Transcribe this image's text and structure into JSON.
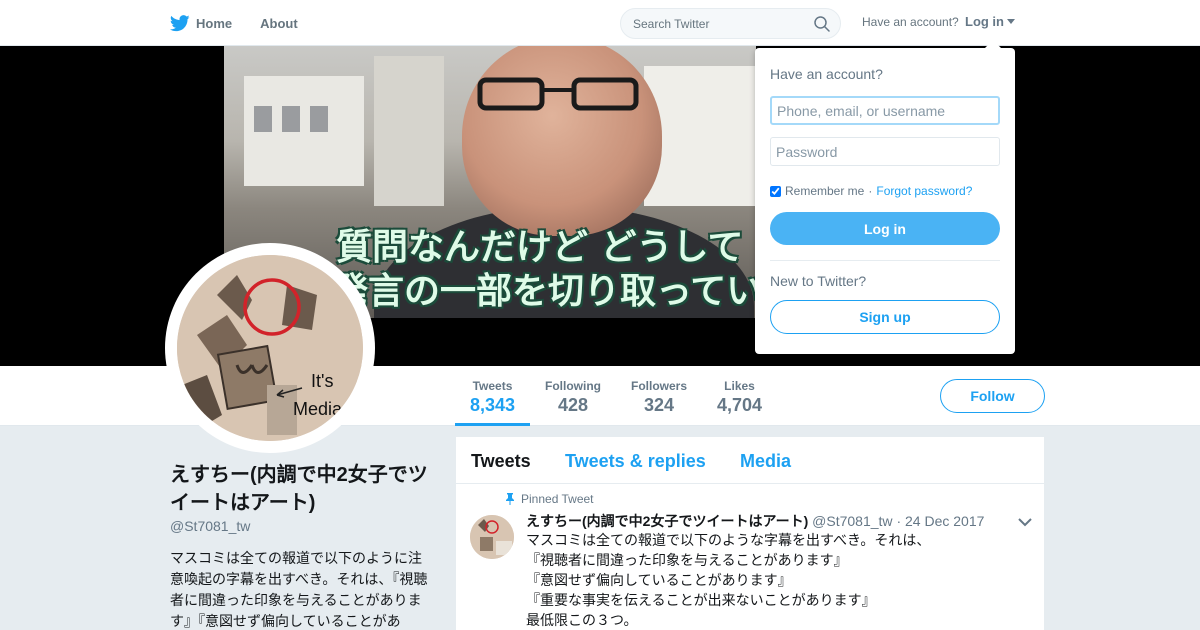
{
  "nav": {
    "home_label": "Home",
    "about_label": "About",
    "search_placeholder": "Search Twitter",
    "have_account": "Have an account?",
    "login_label": "Log in"
  },
  "header": {
    "subtitle_line1": "質問なんだけど どうして",
    "subtitle_line2": "発言の一部を切り取っている"
  },
  "avatar_caption": {
    "line1": "It's",
    "line2": "Media"
  },
  "stats": [
    {
      "label": "Tweets",
      "value": "8,343",
      "active": true
    },
    {
      "label": "Following",
      "value": "428"
    },
    {
      "label": "Followers",
      "value": "324"
    },
    {
      "label": "Likes",
      "value": "4,704"
    }
  ],
  "follow_label": "Follow",
  "profile": {
    "name": "えすちー(内調で中2女子でツイートはアート)",
    "handle": "@St7081_tw",
    "bio": "マスコミは全ての報道で以下のように注意喚起の字幕を出すべき。それは、『視聴者に間違った印象を与えることがあります』『意図せず偏向していることがあ"
  },
  "tabs": [
    "Tweets",
    "Tweets & replies",
    "Media"
  ],
  "tweet": {
    "pinned_label": "Pinned Tweet",
    "name": "えすちー(内調で中2女子でツイートはアート)",
    "handle": "@St7081_tw",
    "separator": "·",
    "date": "24 Dec 2017",
    "lines": [
      "マスコミは全ての報道で以下のような字幕を出すべき。それは、",
      "『視聴者に間違った印象を与えることがあります』",
      "『意図せず偏向していることがあります』",
      "『重要な事実を伝えることが出来ないことがあります』",
      "最低限この３つ。"
    ]
  },
  "login_dropdown": {
    "title": "Have an account?",
    "username_placeholder": "Phone, email, or username",
    "password_placeholder": "Password",
    "remember_label": "Remember me",
    "dot": "·",
    "forgot_label": "Forgot password?",
    "login_button": "Log in",
    "new_label": "New to Twitter?",
    "signup_button": "Sign up"
  },
  "colors": {
    "accent": "#1da1f2",
    "login_button": "#4ab3f4",
    "background": "#e6ecf0"
  }
}
